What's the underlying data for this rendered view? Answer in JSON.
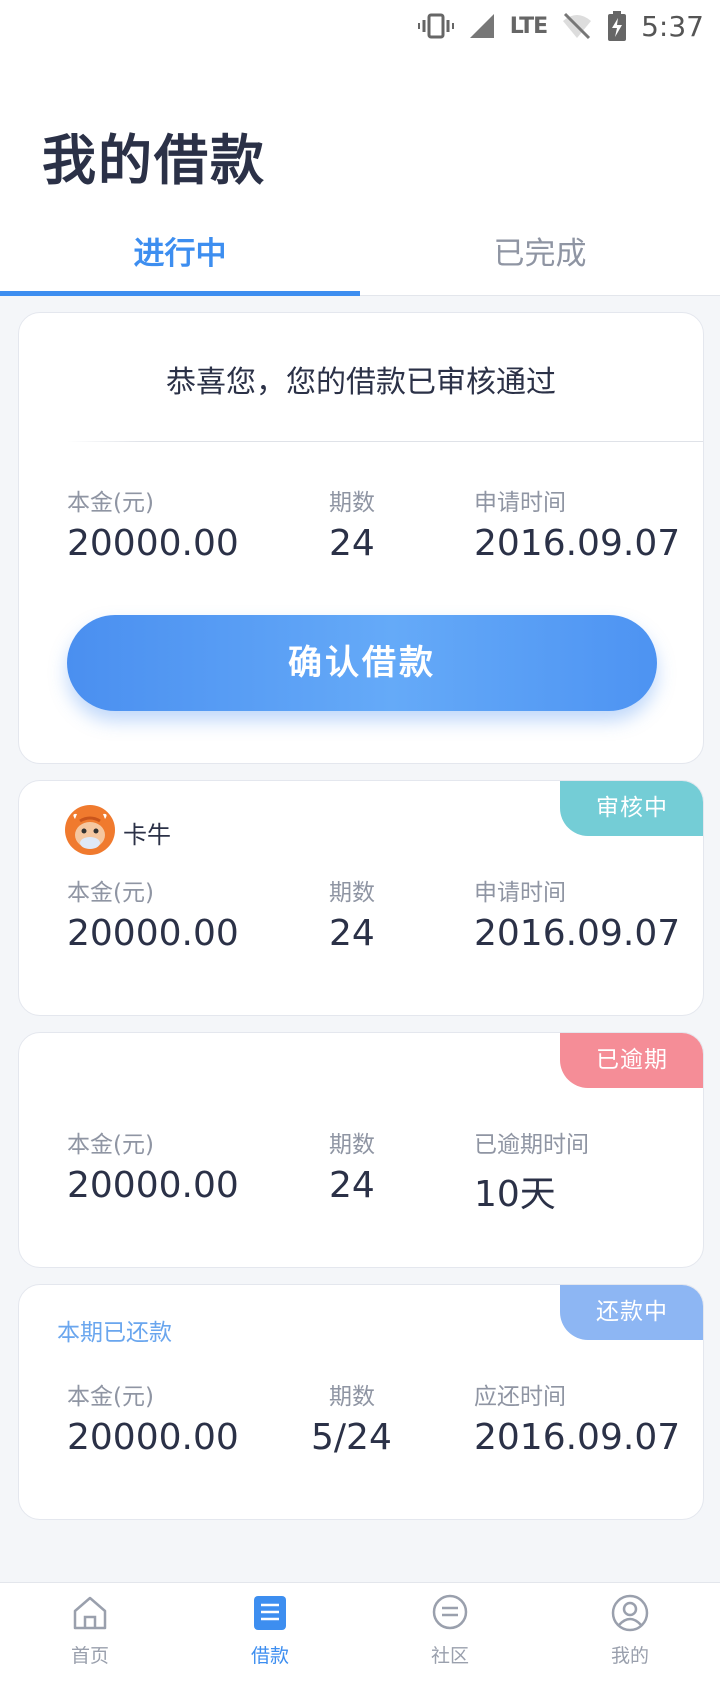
{
  "status_bar": {
    "network": "LTE",
    "time": "5:37"
  },
  "page_title": "我的借款",
  "tabs": [
    {
      "label": "进行中",
      "active": true
    },
    {
      "label": "已完成",
      "active": false
    }
  ],
  "cards": [
    {
      "message": "恭喜您，您的借款已审核通过",
      "labels": [
        "本金(元)",
        "期数",
        "申请时间"
      ],
      "values": [
        "20000.00",
        "24",
        "2016.09.07"
      ],
      "button_label": "确认借款"
    },
    {
      "lender_name": "卡牛",
      "badge": "审核中",
      "labels": [
        "本金(元)",
        "期数",
        "申请时间"
      ],
      "values": [
        "20000.00",
        "24",
        "2016.09.07"
      ]
    },
    {
      "badge": "已逾期",
      "labels": [
        "本金(元)",
        "期数",
        "已逾期时间"
      ],
      "values": [
        "20000.00",
        "24",
        "10天"
      ]
    },
    {
      "note": "本期已还款",
      "badge": "还款中",
      "labels": [
        "本金(元)",
        "期数",
        "应还时间"
      ],
      "values": [
        "20000.00",
        "5/24",
        "2016.09.07"
      ]
    }
  ],
  "bottom_nav": [
    {
      "label": "首页",
      "icon": "home-icon",
      "active": false
    },
    {
      "label": "借款",
      "icon": "loan-document-icon",
      "active": true
    },
    {
      "label": "社区",
      "icon": "chat-bubble-icon",
      "active": false
    },
    {
      "label": "我的",
      "icon": "user-icon",
      "active": false
    }
  ],
  "colors": {
    "accent": "#3d8ef0",
    "badge_review": "#74cdd6",
    "badge_overdue": "#f58d97",
    "badge_repaying": "#8db6f3",
    "text_primary": "#2b3147",
    "text_secondary": "#8f95a3"
  }
}
